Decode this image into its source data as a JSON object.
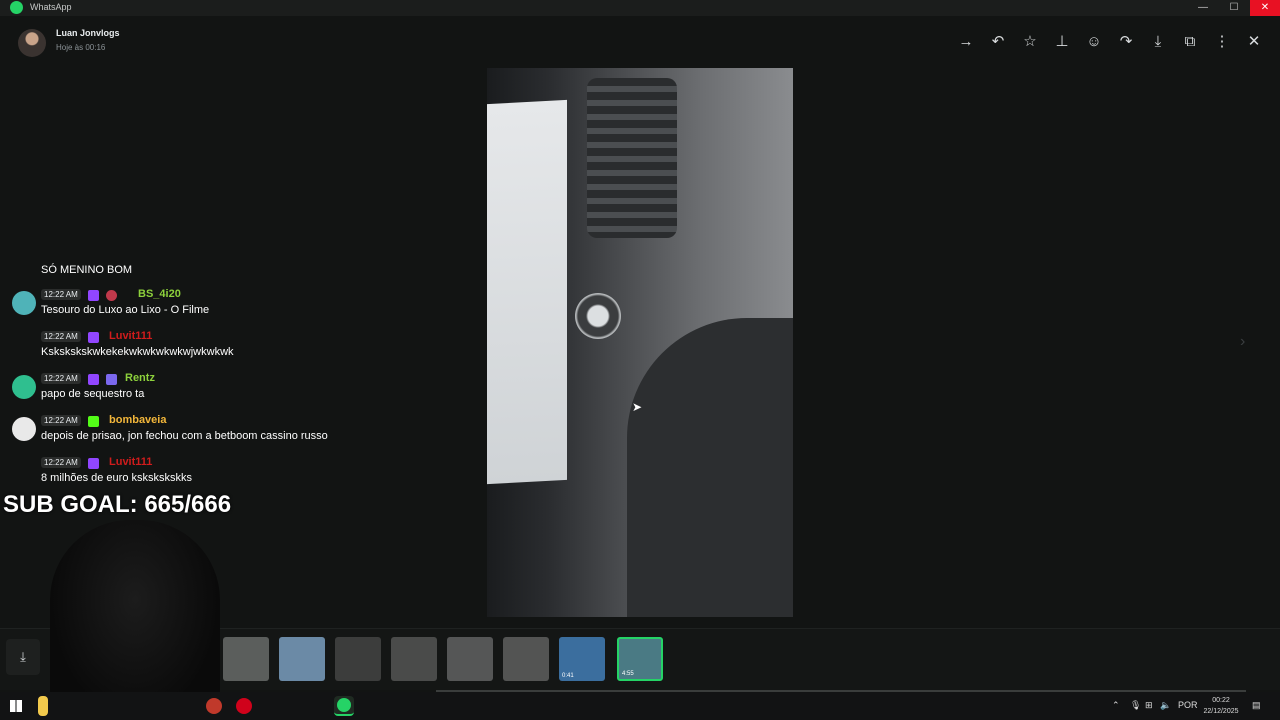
{
  "window": {
    "title": "WhatsApp",
    "controls": {
      "minimize": "—",
      "maximize": "☐",
      "close": "✕"
    }
  },
  "header": {
    "sender_name": "Luan Jonvlogs",
    "timestamp": "Hoje às 00:16",
    "icons": [
      "arrow-right-icon",
      "reply-icon",
      "star-icon",
      "pin-icon",
      "emoji-icon",
      "forward-icon",
      "download-icon",
      "open-external-icon",
      "more-icon",
      "close-icon"
    ],
    "icon_glyphs": {
      "go": "→",
      "reply": "↶",
      "star": "☆",
      "pin": "⊥",
      "emoji": "☺",
      "forward": "↷",
      "download": "⤓",
      "open": "⧉",
      "more": "⋮",
      "close": "✕"
    }
  },
  "chat_overlay": {
    "first_line": "SÓ MENINO BOM",
    "messages": [
      {
        "time": "12:22 AM",
        "user": "BS_4i20",
        "user_color": "#8dd13c",
        "avatar_color": "#4fb3b8",
        "text": "Tesouro do Luxo ao Lixo - O Filme"
      },
      {
        "time": "12:22 AM",
        "user": "Luvit111",
        "user_color": "#d01c1c",
        "avatar_color": "#121413",
        "text": "Kskskskskwkekekwkwkwkwkwjwkwkwk"
      },
      {
        "time": "12:22 AM",
        "user": "Rentz",
        "user_color": "#8dd13c",
        "avatar_color": "#2fbf8f",
        "text": "papo de sequestro ta"
      },
      {
        "time": "12:22 AM",
        "user": "bombaveia",
        "user_color": "#f2b63a",
        "avatar_color": "#e9e9e9",
        "text": "depois de prisao, jon fechou com a betboom cassino russo"
      },
      {
        "time": "12:22 AM",
        "user": "Luvit111",
        "user_color": "#d01c1c",
        "avatar_color": "#121413",
        "text": "8 milhões de euro kskskskskks"
      }
    ],
    "sub_goal": "SUB GOAL: 665/666"
  },
  "media_strip": {
    "thumbnails": [
      {
        "duration": "",
        "color": "#5b5e5c"
      },
      {
        "duration": "",
        "color": "#6b8aa6"
      },
      {
        "duration": "",
        "color": "#3c3d3c"
      },
      {
        "duration": "",
        "color": "#4a4b4a"
      },
      {
        "duration": "",
        "color": "#555656"
      },
      {
        "duration": "",
        "color": "#535453"
      },
      {
        "duration": "0:41",
        "color": "#3b6e9e"
      },
      {
        "duration": "4:55",
        "color": "#4a7a84",
        "selected": true
      }
    ]
  },
  "taskbar": {
    "lang": "POR",
    "time": "00:22",
    "date": "22/12/2025"
  }
}
